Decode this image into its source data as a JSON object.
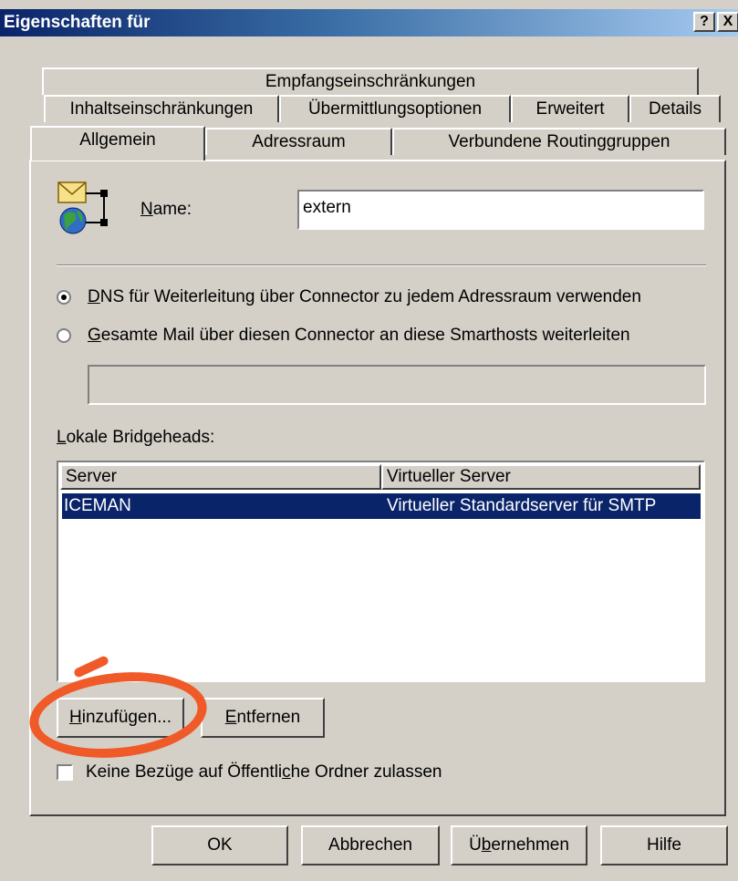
{
  "window": {
    "title": "Eigenschaften für",
    "help_button": "?",
    "close_button": "X"
  },
  "tabs": {
    "row1": [
      "Empfangseinschränkungen"
    ],
    "row2": [
      "Inhaltseinschränkungen",
      "Übermittlungsoptionen",
      "Erweitert",
      "Details"
    ],
    "row3": [
      "Allgemein",
      "Adressraum",
      "Verbundene Routinggruppen"
    ],
    "active": "Allgemein"
  },
  "general": {
    "icon": "mail-connector-icon",
    "name_label_u": "N",
    "name_label_rest": "ame:",
    "name_value": "extern"
  },
  "routing": {
    "option_dns_u": "D",
    "option_dns_rest": "NS für Weiterleitung über Connector zu jedem Adressraum verwenden",
    "option_smarthost_u": "G",
    "option_smarthost_rest": "esamte Mail über diesen Connector an diese Smarthosts weiterleiten",
    "selected": "dns",
    "smarthost_value": ""
  },
  "bridgeheads": {
    "label_u": "L",
    "label_rest": "okale Bridgeheads:",
    "columns": [
      "Server",
      "Virtueller Server"
    ],
    "rows": [
      {
        "server": "ICEMAN",
        "virtual_server": "Virtueller Standardserver für SMTP",
        "selected": true
      }
    ],
    "add_button_u": "H",
    "add_button_rest": "inzufügen...",
    "remove_button_u": "E",
    "remove_button_rest": "ntfernen"
  },
  "public_folders": {
    "checkbox_pre": "Keine Bezüge auf Öffentli",
    "checkbox_u": "c",
    "checkbox_post": "he Ordner zulassen",
    "checked": false
  },
  "footer": {
    "ok": "OK",
    "cancel": "Abbrechen",
    "apply_pre": "Ü",
    "apply_u": "b",
    "apply_post": "ernehmen",
    "help": "Hilfe"
  },
  "colors": {
    "face": "#d4d0c8",
    "title_start": "#0a246a",
    "title_end": "#a6caf0",
    "selection": "#0a246a",
    "annotation": "#f05a28"
  }
}
